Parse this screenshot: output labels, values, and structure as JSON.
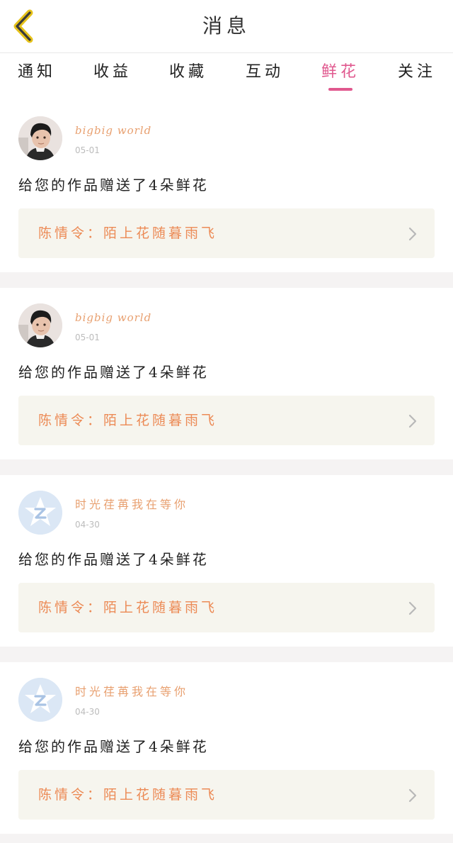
{
  "header": {
    "title": "消息",
    "back_icon": "chevron-left-icon",
    "back_color": "#e6c21a"
  },
  "tabs": [
    {
      "label": "通知",
      "active": false
    },
    {
      "label": "收益",
      "active": false
    },
    {
      "label": "收藏",
      "active": false
    },
    {
      "label": "互动",
      "active": false
    },
    {
      "label": "鲜花",
      "active": true
    },
    {
      "label": "关注",
      "active": false
    }
  ],
  "accent_color": "#e0588e",
  "messages": [
    {
      "username": "bigbig world",
      "date": "05-01",
      "avatar": "photo",
      "text": "给您的作品赠送了4朵鲜花",
      "work_title": "陈情令：陌上花随暮雨飞"
    },
    {
      "username": "bigbig world",
      "date": "05-01",
      "avatar": "photo",
      "text": "给您的作品赠送了4朵鲜花",
      "work_title": "陈情令：陌上花随暮雨飞"
    },
    {
      "username": "时光荏苒我在等你",
      "date": "04-30",
      "avatar": "qq-default",
      "text": "给您的作品赠送了4朵鲜花",
      "work_title": "陈情令：陌上花随暮雨飞"
    },
    {
      "username": "时光荏苒我在等你",
      "date": "04-30",
      "avatar": "qq-default",
      "text": "给您的作品赠送了4朵鲜花",
      "work_title": "陈情令：陌上花随暮雨飞"
    }
  ]
}
